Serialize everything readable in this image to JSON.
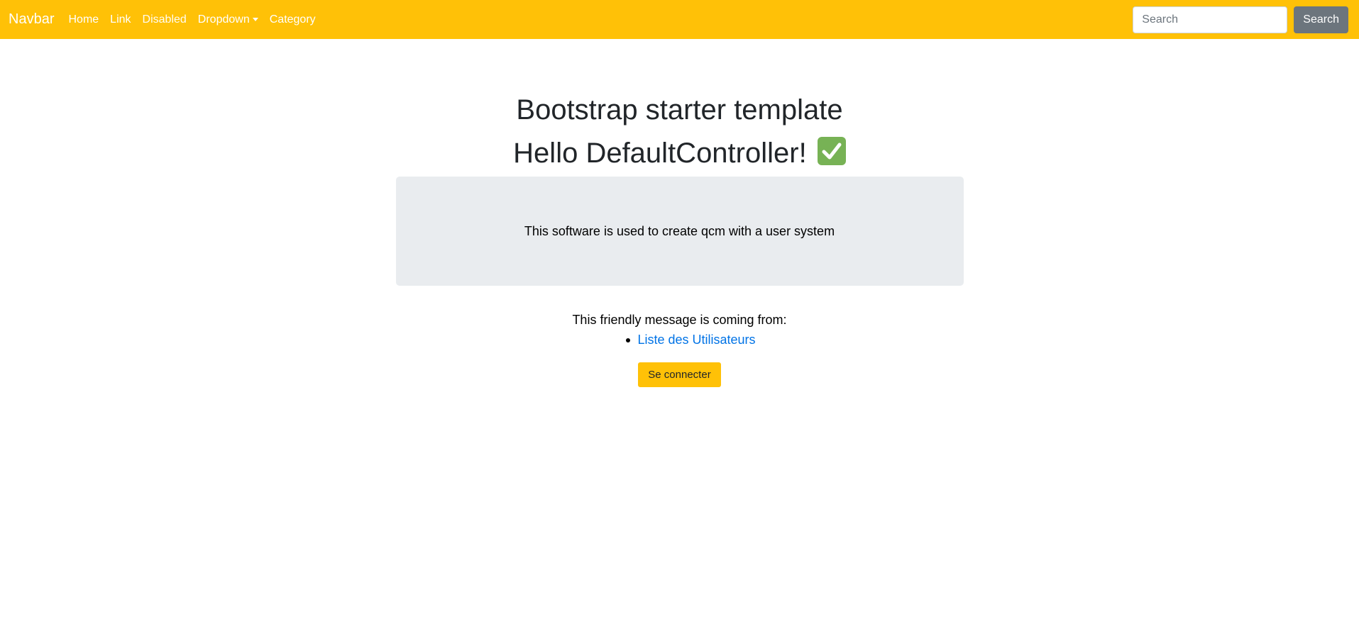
{
  "navbar": {
    "brand": "Navbar",
    "links": [
      {
        "label": "Home"
      },
      {
        "label": "Link"
      },
      {
        "label": "Disabled"
      },
      {
        "label": "Dropdown"
      },
      {
        "label": "Category"
      }
    ],
    "search": {
      "placeholder": "Search",
      "button_label": "Search"
    },
    "background_color": "#ffc107"
  },
  "main": {
    "title": "Bootstrap starter template",
    "hello": "Hello DefaultController!",
    "hello_icon": "check-mark-button-icon",
    "jumbotron_text": "This software is used to create qcm with a user system",
    "friendly_message": "This friendly message is coming from:",
    "links": [
      {
        "label": "Liste des Utilisateurs"
      }
    ],
    "connect_button": "Se connecter"
  }
}
